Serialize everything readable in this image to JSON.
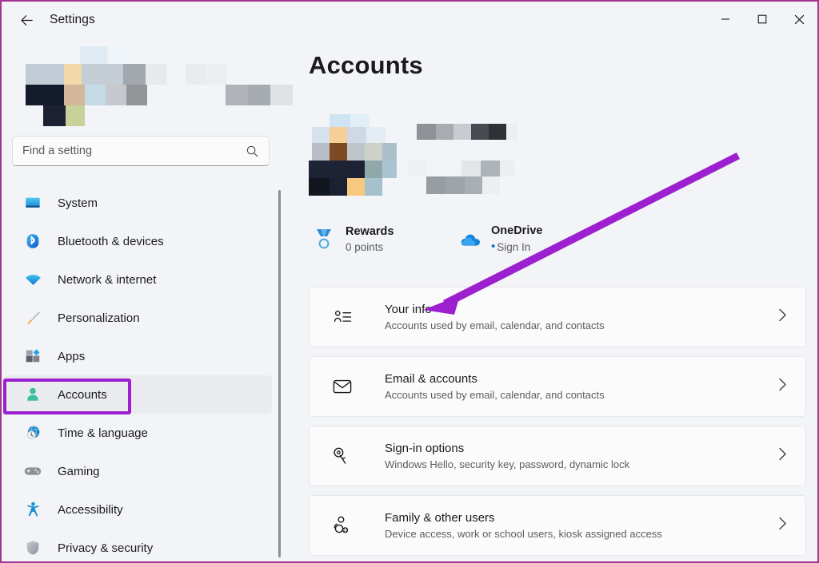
{
  "window": {
    "app_title": "Settings",
    "back_icon": "back-arrow-icon",
    "minimize_label": "—",
    "maximize_label": "□",
    "close_label": "✕"
  },
  "search": {
    "placeholder": "Find a setting",
    "value": "",
    "icon": "search-icon"
  },
  "sidebar": {
    "user_banner": "censored-account-name",
    "items": [
      {
        "label": "System",
        "icon": "monitor-icon",
        "selected": false
      },
      {
        "label": "Bluetooth & devices",
        "icon": "bluetooth-icon",
        "selected": false
      },
      {
        "label": "Network & internet",
        "icon": "wifi-icon",
        "selected": false
      },
      {
        "label": "Personalization",
        "icon": "paintbrush-icon",
        "selected": false
      },
      {
        "label": "Apps",
        "icon": "apps-icon",
        "selected": false
      },
      {
        "label": "Accounts",
        "icon": "person-icon",
        "selected": true
      },
      {
        "label": "Time & language",
        "icon": "clock-globe-icon",
        "selected": false
      },
      {
        "label": "Gaming",
        "icon": "gamepad-icon",
        "selected": false
      },
      {
        "label": "Accessibility",
        "icon": "accessibility-icon",
        "selected": false
      },
      {
        "label": "Privacy & security",
        "icon": "shield-icon",
        "selected": false
      }
    ]
  },
  "main": {
    "page_title": "Accounts",
    "profile": {
      "name": "censored-user-name",
      "email": "censored-user-email",
      "avatar": "censored-profile-picture"
    },
    "links": [
      {
        "title": "Rewards",
        "subtitle": "0 points",
        "icon": "rewards-medal-icon",
        "has_dot": false
      },
      {
        "title": "OneDrive",
        "subtitle": "Sign In",
        "icon": "onedrive-cloud-icon",
        "has_dot": true
      }
    ],
    "cards": [
      {
        "title": "Your info",
        "subtitle": "Accounts used by email, calendar, and contacts",
        "icon": "your-info-icon",
        "chevron": "chevron-right-icon"
      },
      {
        "title": "Email & accounts",
        "subtitle": "Accounts used by email, calendar, and contacts",
        "icon": "envelope-icon",
        "chevron": "chevron-right-icon"
      },
      {
        "title": "Sign-in options",
        "subtitle": "Windows Hello, security key, password, dynamic lock",
        "icon": "key-icon",
        "chevron": "chevron-right-icon"
      },
      {
        "title": "Family & other users",
        "subtitle": "Device access, work or school users, kiosk assigned access",
        "icon": "add-user-icon",
        "chevron": "chevron-right-icon"
      }
    ]
  },
  "annotations": {
    "highlight_color": "#9c1fd0",
    "arrow_color": "#9c1fd0",
    "accounts_highlight_target": "Accounts",
    "arrow_target": "Your info"
  },
  "colors": {
    "accent": "#0067c0",
    "window_border": "#a4368f",
    "background": "#f2f4f7",
    "card_background": "#fbfbfb",
    "text_primary": "#1b1b1b",
    "text_secondary": "#5d5d5d"
  }
}
